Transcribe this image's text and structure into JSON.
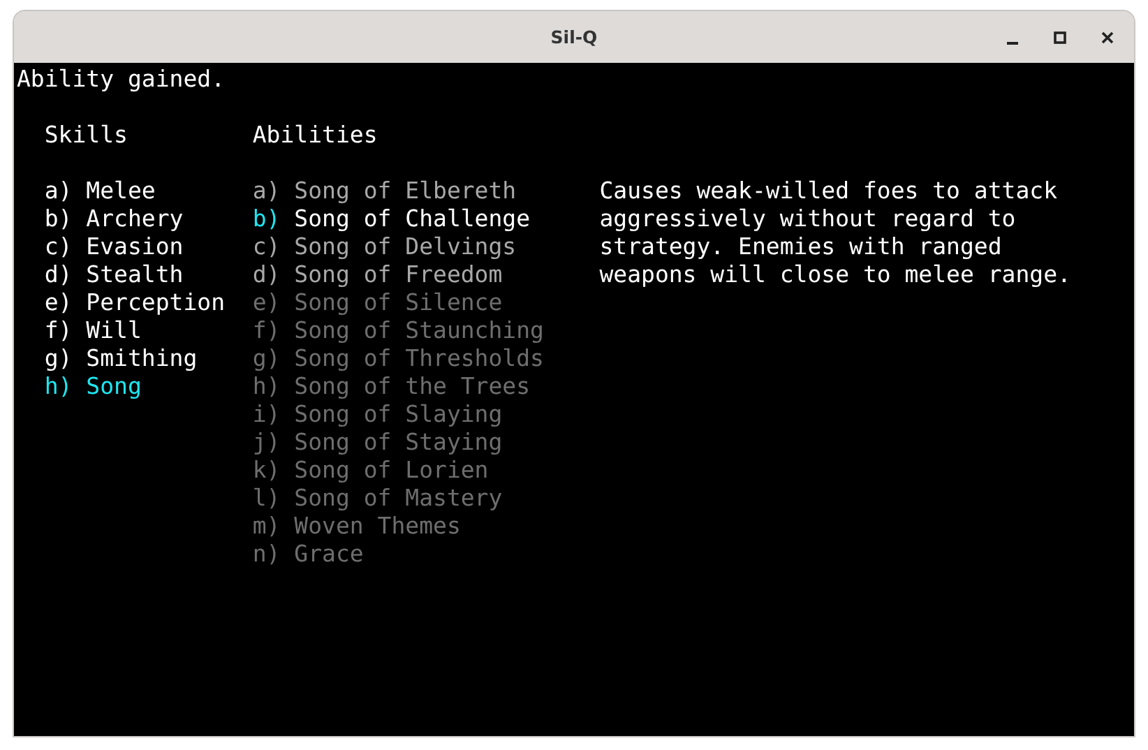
{
  "window": {
    "title": "Sil-Q"
  },
  "message": "Ability gained.",
  "skills": {
    "heading": "Skills",
    "items": [
      {
        "key": "a)",
        "name": "Melee",
        "selected": false
      },
      {
        "key": "b)",
        "name": "Archery",
        "selected": false
      },
      {
        "key": "c)",
        "name": "Evasion",
        "selected": false
      },
      {
        "key": "d)",
        "name": "Stealth",
        "selected": false
      },
      {
        "key": "e)",
        "name": "Perception",
        "selected": false
      },
      {
        "key": "f)",
        "name": "Will",
        "selected": false
      },
      {
        "key": "g)",
        "name": "Smithing",
        "selected": false
      },
      {
        "key": "h)",
        "name": "Song",
        "selected": true
      }
    ]
  },
  "abilities": {
    "heading": "Abilities",
    "items": [
      {
        "key": "a)",
        "name": "Song of Elbereth",
        "selected": false,
        "available": true
      },
      {
        "key": "b)",
        "name": "Song of Challenge",
        "selected": true,
        "available": true
      },
      {
        "key": "c)",
        "name": "Song of Delvings",
        "selected": false,
        "available": true
      },
      {
        "key": "d)",
        "name": "Song of Freedom",
        "selected": false,
        "available": true
      },
      {
        "key": "e)",
        "name": "Song of Silence",
        "selected": false,
        "available": false
      },
      {
        "key": "f)",
        "name": "Song of Staunching",
        "selected": false,
        "available": false
      },
      {
        "key": "g)",
        "name": "Song of Thresholds",
        "selected": false,
        "available": false
      },
      {
        "key": "h)",
        "name": "Song of the Trees",
        "selected": false,
        "available": false
      },
      {
        "key": "i)",
        "name": "Song of Slaying",
        "selected": false,
        "available": false
      },
      {
        "key": "j)",
        "name": "Song of Staying",
        "selected": false,
        "available": false
      },
      {
        "key": "k)",
        "name": "Song of Lorien",
        "selected": false,
        "available": false
      },
      {
        "key": "l)",
        "name": "Song of Mastery",
        "selected": false,
        "available": false
      },
      {
        "key": "m)",
        "name": "Woven Themes",
        "selected": false,
        "available": false
      },
      {
        "key": "n)",
        "name": "Grace",
        "selected": false,
        "available": false
      }
    ]
  },
  "description": [
    "Causes weak-willed foes to attack",
    "aggressively without regard to",
    "strategy. Enemies with ranged",
    "weapons will close to melee range."
  ]
}
